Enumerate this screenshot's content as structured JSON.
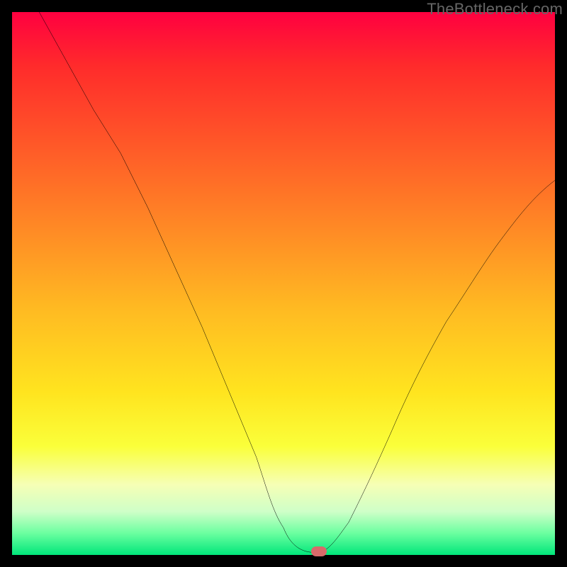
{
  "watermark": "TheBottleneck.com",
  "marker": {
    "x_frac": 0.565,
    "y_frac": 0.993
  },
  "chart_data": {
    "type": "line",
    "title": "",
    "xlabel": "",
    "ylabel": "",
    "xlim": [
      0,
      100
    ],
    "ylim": [
      0,
      100
    ],
    "grid": false,
    "legend": false,
    "annotations": [],
    "series": [
      {
        "name": "bottleneck-curve",
        "x": [
          5,
          10,
          15,
          20,
          25,
          30,
          35,
          40,
          45,
          48,
          50,
          52,
          55,
          57,
          60,
          62,
          65,
          70,
          75,
          80,
          85,
          90,
          95,
          100
        ],
        "y": [
          100,
          91,
          82,
          74,
          64,
          53,
          42,
          30,
          18,
          10,
          5,
          2,
          0.5,
          0.5,
          2,
          6,
          12,
          23,
          33,
          43,
          51,
          58,
          64,
          69
        ]
      }
    ],
    "marker": {
      "x": 56.5,
      "y": 0.7
    },
    "background_gradient": {
      "top": "#ff0040",
      "mid": "#ffe41f",
      "bottom": "#00e67a"
    }
  }
}
